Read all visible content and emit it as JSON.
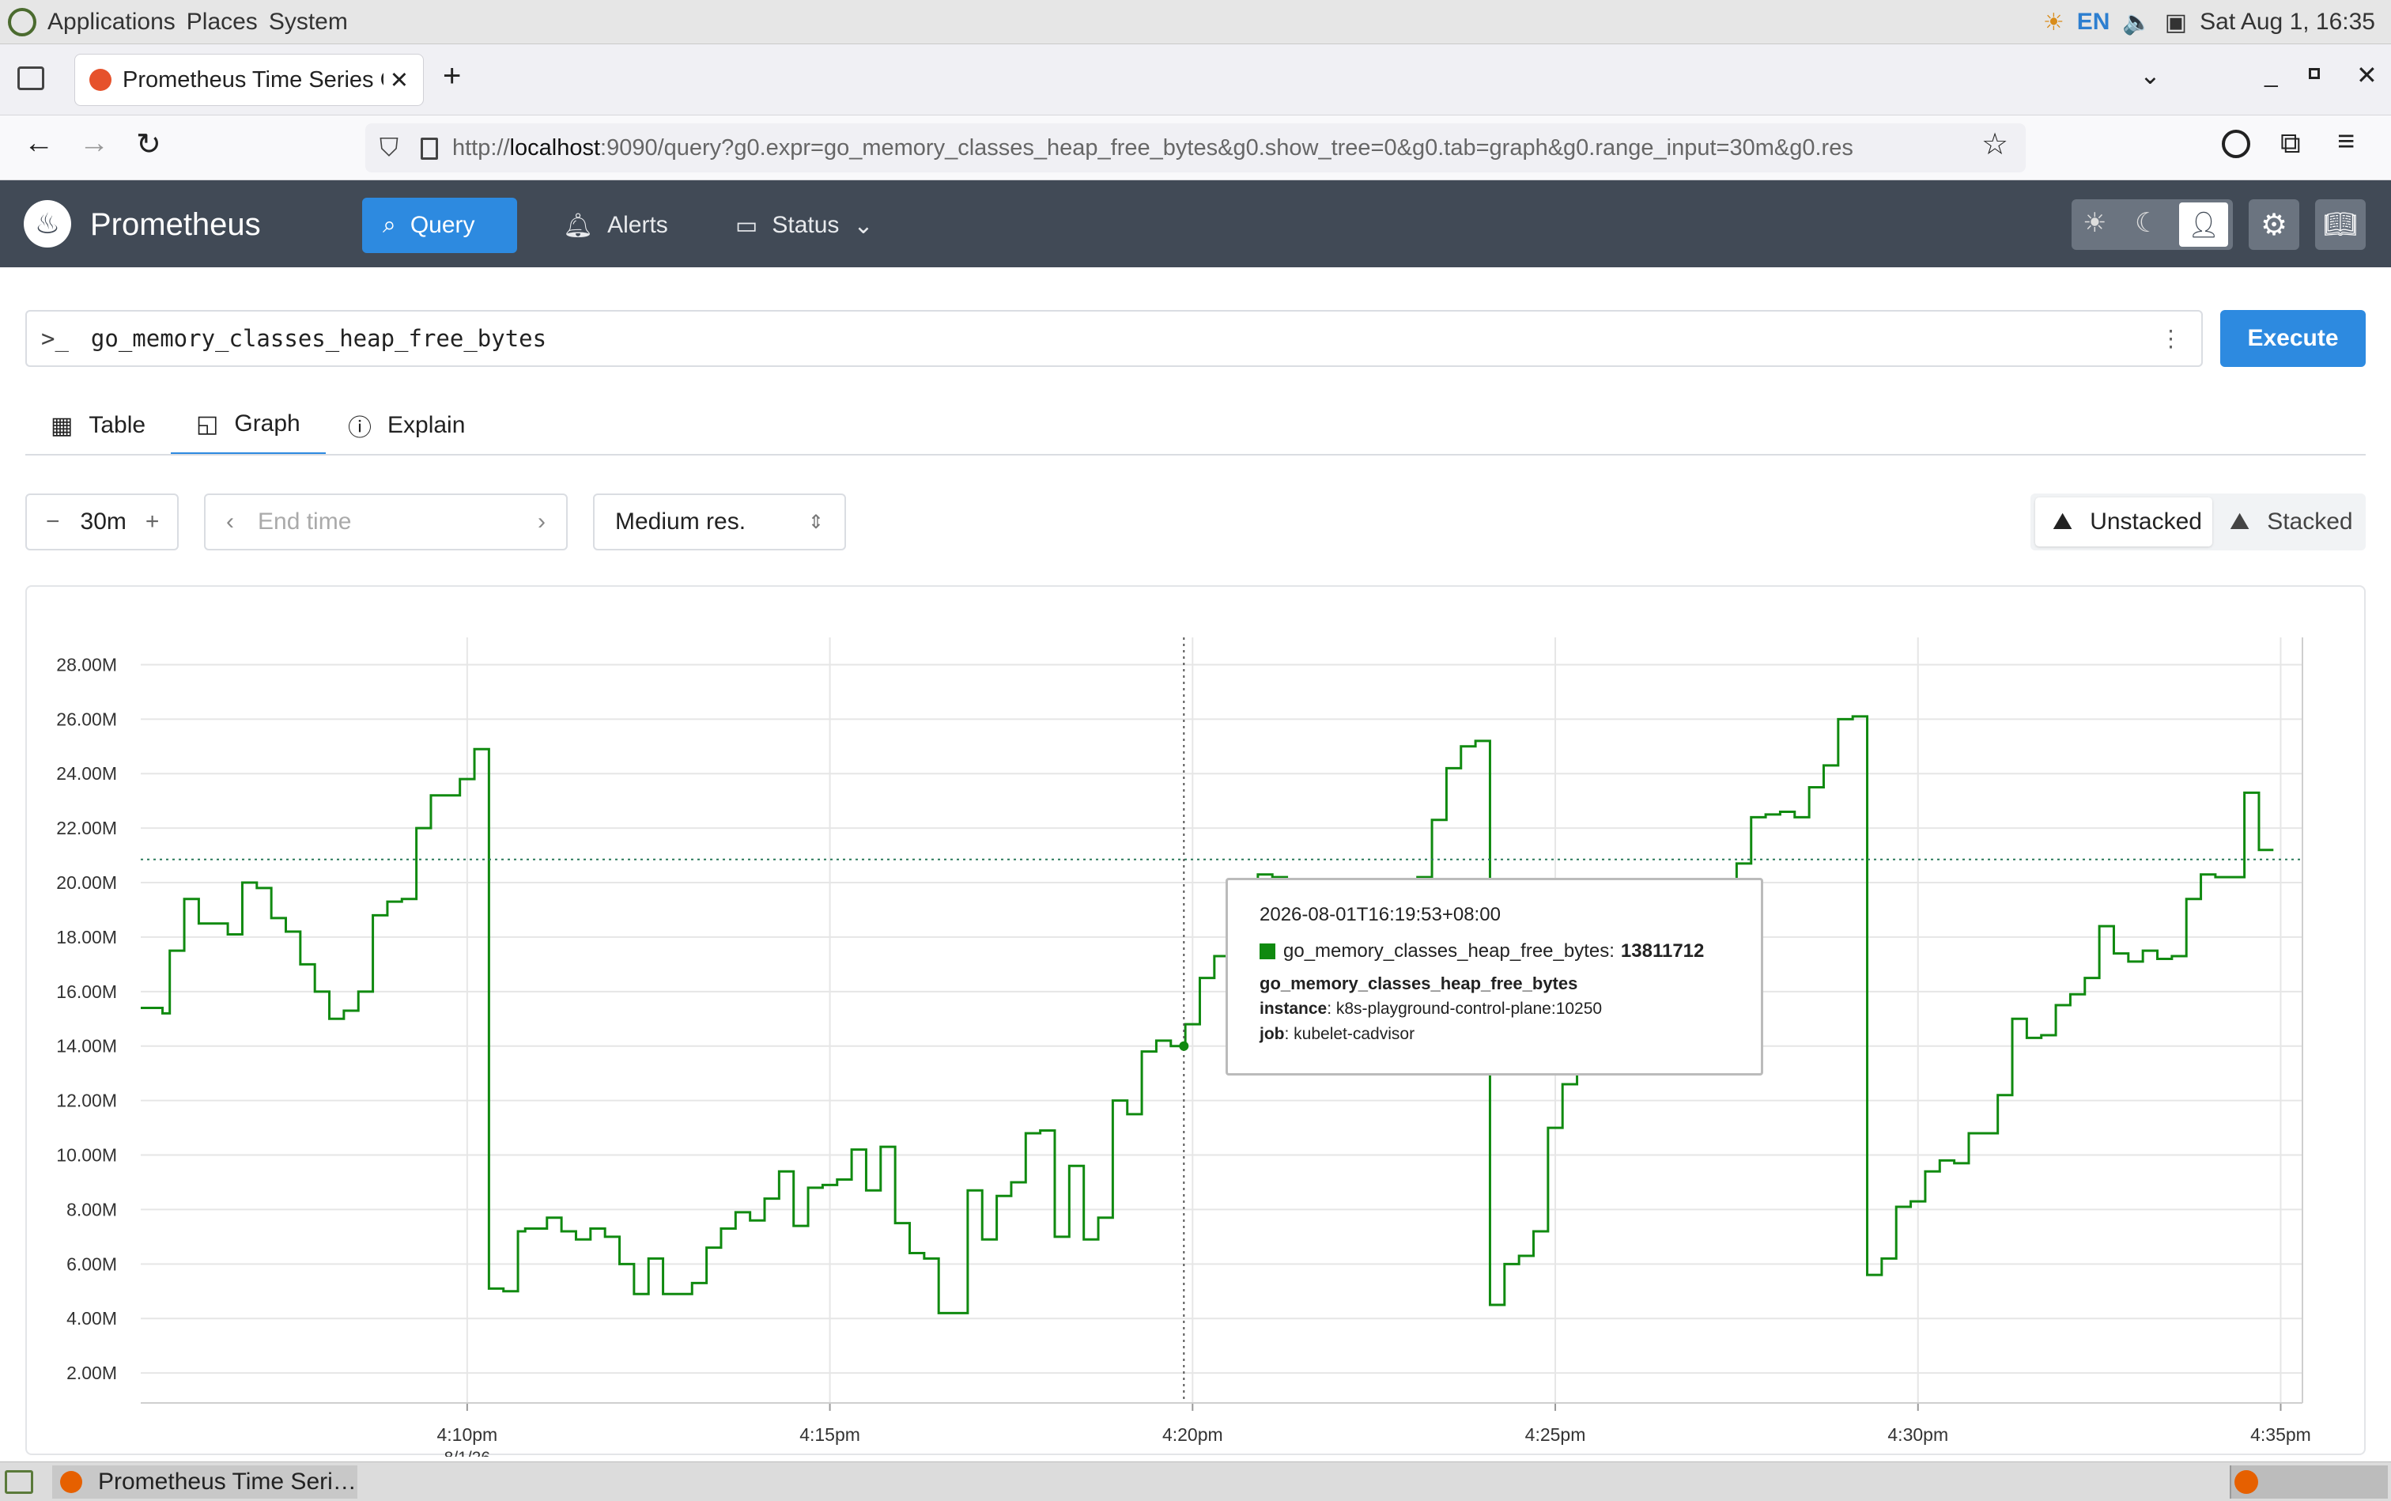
{
  "os": {
    "menus": [
      "Applications",
      "Places",
      "System"
    ],
    "lang": "EN",
    "clock": "Sat Aug 1, 16:35"
  },
  "browser": {
    "tab_title": "Prometheus Time Series C",
    "url_prefix": "http://",
    "url_host": "localhost",
    "url_rest": ":9090/query?g0.expr=go_memory_classes_heap_free_bytes&g0.show_tree=0&g0.tab=graph&g0.range_input=30m&g0.res"
  },
  "app": {
    "brand": "Prometheus",
    "nav": {
      "query": "Query",
      "alerts": "Alerts",
      "status": "Status"
    }
  },
  "query": {
    "prompt": ">_",
    "expr": "go_memory_classes_heap_free_bytes",
    "execute": "Execute"
  },
  "tabs": {
    "table": "Table",
    "graph": "Graph",
    "explain": "Explain"
  },
  "controls": {
    "range": "30m",
    "end_time_placeholder": "End time",
    "resolution": "Medium res.",
    "unstacked": "Unstacked",
    "stacked": "Stacked"
  },
  "tooltip": {
    "time": "2026-08-01T16:19:53+08:00",
    "series_label": "go_memory_classes_heap_free_bytes:",
    "value": "13811712",
    "metric_name": "go_memory_classes_heap_free_bytes",
    "instance_key": "instance",
    "instance_value": ": k8s-playground-control-plane:10250",
    "job_key": "job",
    "job_value": ": kubelet-cadvisor"
  },
  "taskbar": {
    "item": "Prometheus Time Seri…"
  },
  "chart_data": {
    "type": "line",
    "title": "",
    "xlabel": "",
    "ylabel": "",
    "x_ticks": [
      "4:10pm",
      "4:15pm",
      "4:20pm",
      "4:25pm",
      "4:30pm",
      "4:35pm"
    ],
    "x_tick_sub": "8/1/26",
    "x_tick_minutes": [
      10,
      15,
      20,
      25,
      30,
      35
    ],
    "y_ticks": [
      "2.00M",
      "4.00M",
      "6.00M",
      "8.00M",
      "10.00M",
      "12.00M",
      "14.00M",
      "16.00M",
      "18.00M",
      "20.00M",
      "22.00M",
      "24.00M",
      "26.00M",
      "28.00M"
    ],
    "y_tick_values": [
      2,
      4,
      6,
      8,
      10,
      12,
      14,
      16,
      18,
      20,
      22,
      24,
      26,
      28
    ],
    "ylim": [
      0.9,
      29
    ],
    "xlim_minutes": [
      5.5,
      35.3
    ],
    "cursor_minute": 19.88,
    "hover_value_millions": 20.85,
    "series": [
      {
        "name": "go_memory_classes_heap_free_bytes",
        "color": "#108a10",
        "x_minutes": [
          5.5,
          5.8,
          5.9,
          6.1,
          6.3,
          6.5,
          6.7,
          6.9,
          7.1,
          7.3,
          7.5,
          7.7,
          7.9,
          8.1,
          8.3,
          8.5,
          8.7,
          8.9,
          9.1,
          9.3,
          9.5,
          9.7,
          9.9,
          10.1,
          10.3,
          10.5,
          10.7,
          10.8,
          11.1,
          11.3,
          11.5,
          11.7,
          11.9,
          12.1,
          12.3,
          12.5,
          12.7,
          12.9,
          13.1,
          13.3,
          13.5,
          13.7,
          13.9,
          14.1,
          14.3,
          14.5,
          14.7,
          14.9,
          15.1,
          15.3,
          15.5,
          15.7,
          15.9,
          16.1,
          16.3,
          16.5,
          16.7,
          16.9,
          17.1,
          17.3,
          17.5,
          17.7,
          17.9,
          18.1,
          18.3,
          18.5,
          18.7,
          18.9,
          19.1,
          19.3,
          19.5,
          19.7,
          19.9,
          20.1,
          20.3,
          20.5,
          20.7,
          20.9,
          21.1,
          21.3,
          21.5,
          21.7,
          21.9,
          22.1,
          22.3,
          22.5,
          22.7,
          22.9,
          23.1,
          23.3,
          23.5,
          23.7,
          23.9,
          24.1,
          24.3,
          24.5,
          24.7,
          24.9,
          25.1,
          25.3,
          25.5,
          25.7,
          25.9,
          26.1,
          26.3,
          26.5,
          26.7,
          26.9,
          27.1,
          27.3,
          27.5,
          27.7,
          27.9,
          28.1,
          28.3,
          28.5,
          28.7,
          28.9,
          29.1,
          29.3,
          29.5,
          29.7,
          29.9,
          30.1,
          30.3,
          30.5,
          30.7,
          30.9,
          31.1,
          31.3,
          31.5,
          31.7,
          31.9,
          32.1,
          32.3,
          32.5,
          32.7,
          32.9,
          33.1,
          33.3,
          33.5,
          33.7,
          33.9,
          34.1,
          34.3,
          34.5,
          34.7,
          34.9,
          35.1,
          35.3
        ],
        "y_millions": [
          15.4,
          15.2,
          17.5,
          19.4,
          18.5,
          18.5,
          18.1,
          20.0,
          19.8,
          18.7,
          18.2,
          17.0,
          16.0,
          15.0,
          15.3,
          16.0,
          18.8,
          19.3,
          19.4,
          22.0,
          23.2,
          23.2,
          23.8,
          24.9,
          5.1,
          5.0,
          7.2,
          7.3,
          7.7,
          7.2,
          6.9,
          7.3,
          7.0,
          6.0,
          4.9,
          6.2,
          4.9,
          4.9,
          5.3,
          6.6,
          7.3,
          7.9,
          7.6,
          8.4,
          9.4,
          7.4,
          8.8,
          8.9,
          9.1,
          10.2,
          8.7,
          10.3,
          7.5,
          6.4,
          6.2,
          4.2,
          4.2,
          8.7,
          6.9,
          8.5,
          9.0,
          10.8,
          10.9,
          7.0,
          9.6,
          6.9,
          7.7,
          12.0,
          11.5,
          13.8,
          14.2,
          14.0,
          14.8,
          16.5,
          17.3,
          18.2,
          19.0,
          20.3,
          20.2,
          19.4,
          19.0,
          18.2,
          17.8,
          17.9,
          18.2,
          19.0,
          19.8,
          20.0,
          20.2,
          22.3,
          24.2,
          25.0,
          25.2,
          4.5,
          6.0,
          6.3,
          7.2,
          11.0,
          12.6,
          14.2,
          15.6,
          16.9,
          16.1,
          15.7,
          15.5,
          14.9,
          15.7,
          16.4,
          17.4,
          18.6,
          20.7,
          22.4,
          22.5,
          22.6,
          22.4,
          23.5,
          24.3,
          26.0,
          26.1,
          5.6,
          6.2,
          8.1,
          8.3,
          9.4,
          9.8,
          9.7,
          10.8,
          10.8,
          12.2,
          15.0,
          14.3,
          14.4,
          15.5,
          15.9,
          16.5,
          18.4,
          17.4,
          17.1,
          17.5,
          17.2,
          17.3,
          19.4,
          20.3,
          20.2,
          20.2,
          23.3,
          21.2
        ]
      }
    ]
  }
}
